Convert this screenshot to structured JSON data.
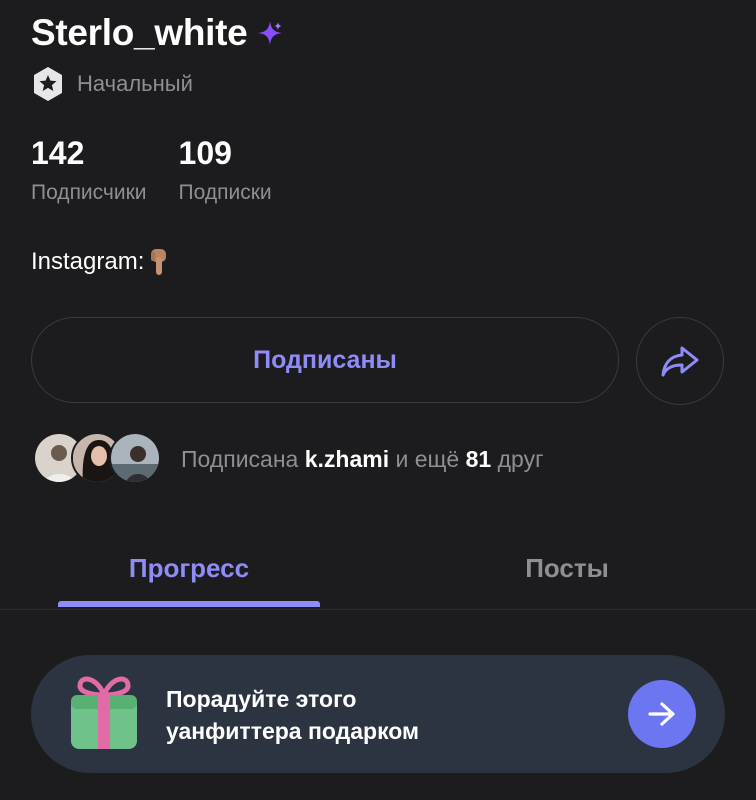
{
  "profile": {
    "username": "Sterlo_white",
    "level": "Начальный",
    "bio": "Instagram:"
  },
  "stats": [
    {
      "value": "142",
      "label": "Подписчики"
    },
    {
      "value": "109",
      "label": "Подписки"
    }
  ],
  "actions": {
    "follow_label": "Подписаны"
  },
  "friends": {
    "prefix": "Подписана",
    "friend_name": "k.zhami",
    "middle": "и ещё",
    "count": "81",
    "suffix": "друг"
  },
  "tabs": [
    {
      "label": "Прогресс",
      "active": true
    },
    {
      "label": "Посты",
      "active": false
    }
  ],
  "gift": {
    "line1": "Порадуйте этого",
    "line2": "уанфиттера подарком"
  },
  "icons": {
    "sparkle": "sparkle-icon",
    "level": "star-badge-icon",
    "share": "share-arrow-icon",
    "gift": "gift-icon",
    "go": "arrow-right-icon",
    "bio_emoji": "pointing-down-emoji"
  },
  "colors": {
    "background": "#1c1c1e",
    "accent": "#8f8cf7",
    "muted": "#8e8e93",
    "gift_card": "#2b3440",
    "go_button": "#6b76f0"
  }
}
